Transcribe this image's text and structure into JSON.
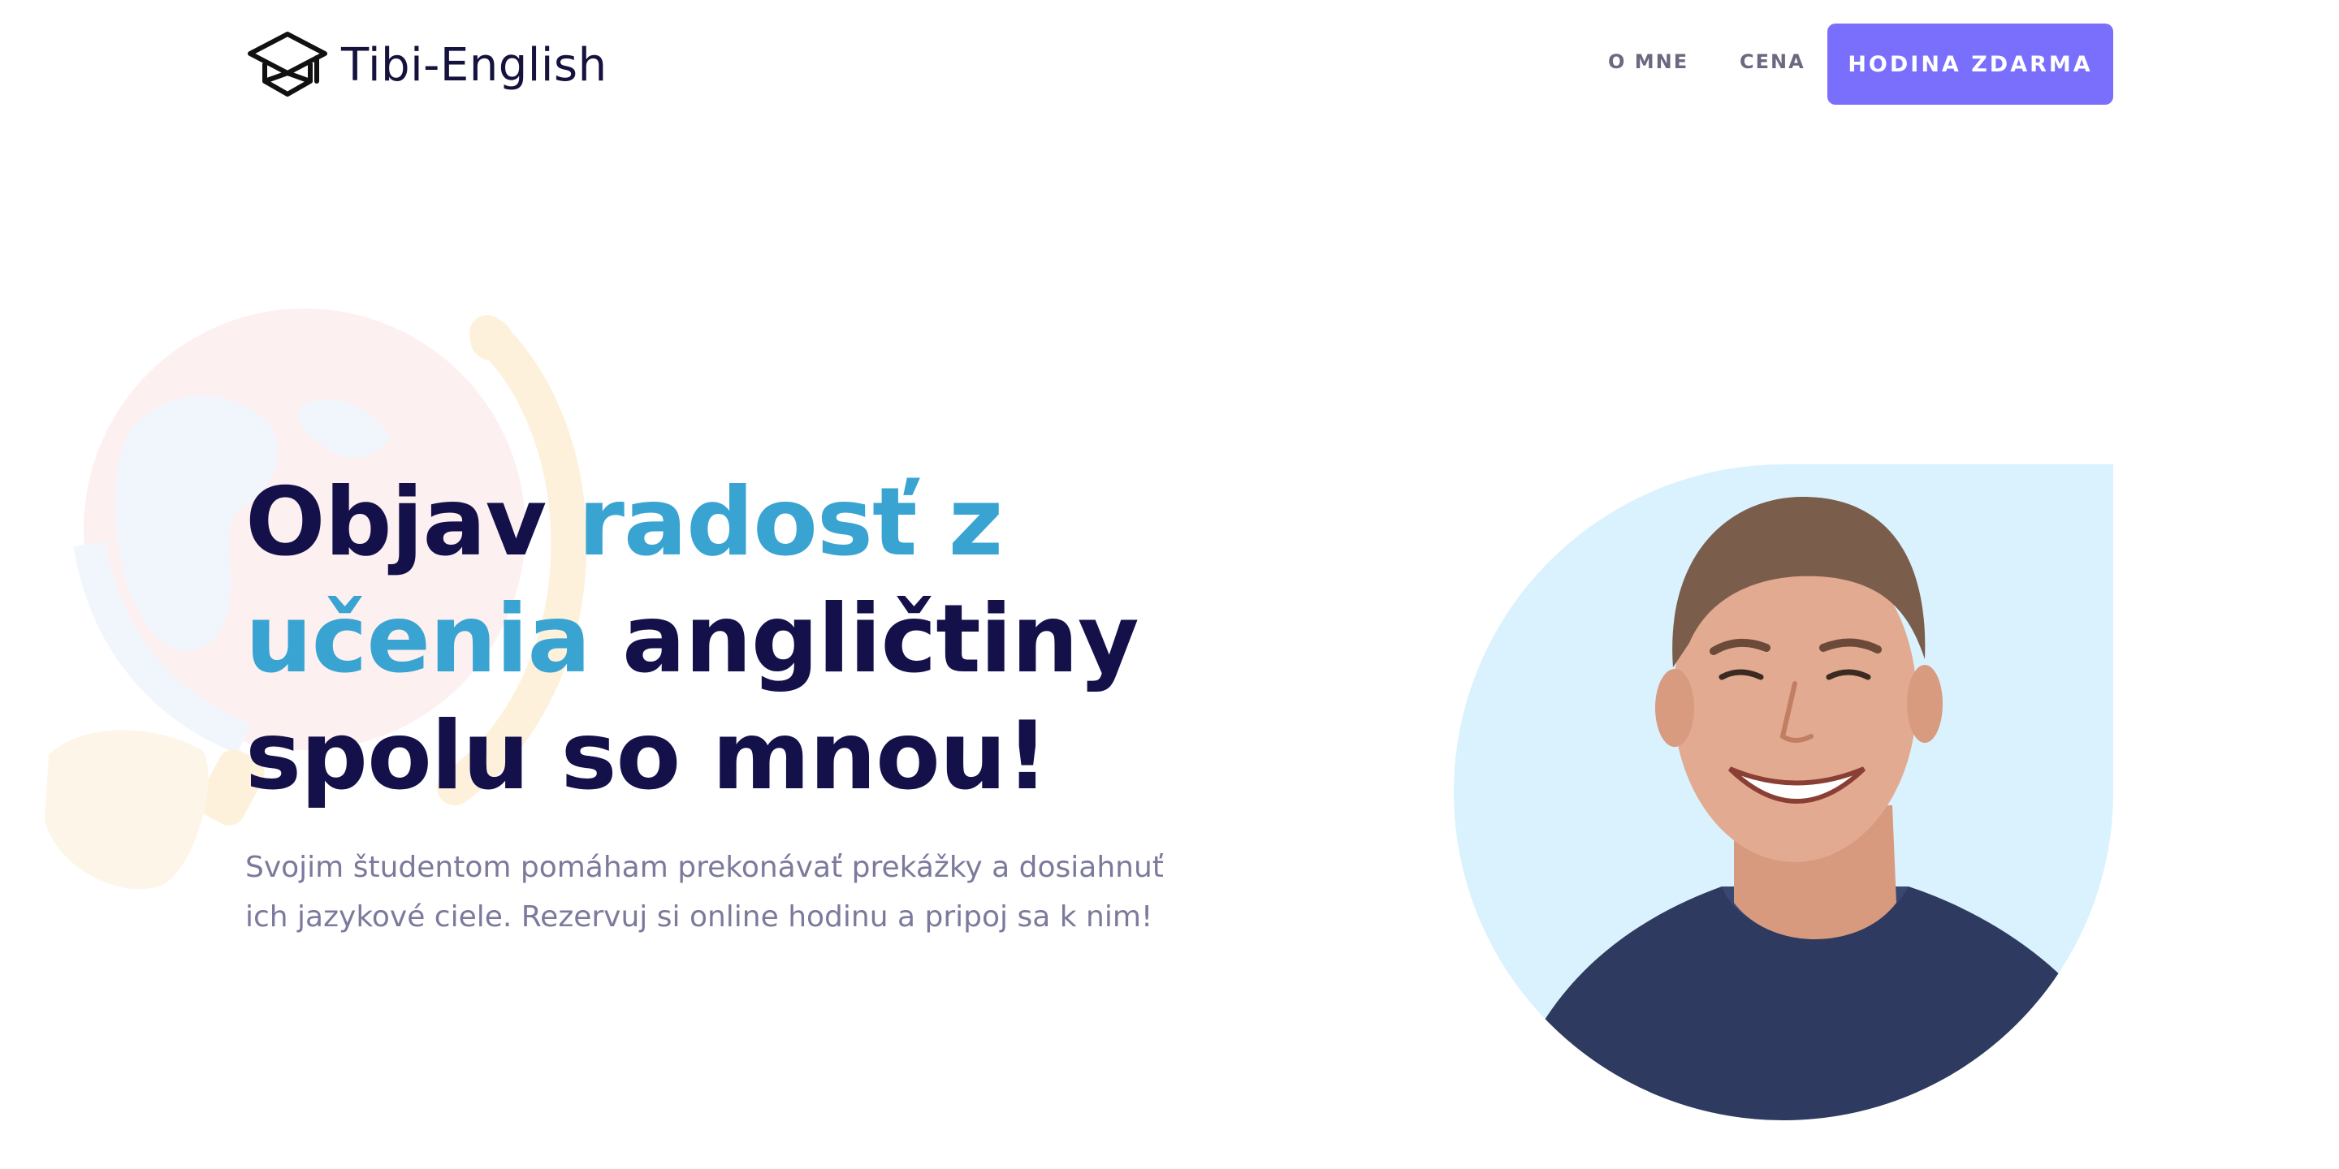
{
  "header": {
    "logo_text": "Tibi-English",
    "logo_icon": "graduation-cap-icon",
    "nav": [
      {
        "label": "O MNE"
      },
      {
        "label": "CENA"
      }
    ],
    "cta_label": "HODINA ZDARMA"
  },
  "hero": {
    "title_part1": "Objav ",
    "title_accent": "radosť z učenia",
    "title_part2": " angličtiny spolu so mnou!",
    "subtitle": "Svojim študentom pomáham prekonávať prekážky a dosiahnuť ich jazykové ciele. Rezervuj si online hodinu a pripoj sa k nim!"
  },
  "decor": {
    "background_icon": "globe-icon",
    "portrait": "tutor-photo"
  },
  "colors": {
    "accent_purple": "#7a6efc",
    "accent_blue": "#39a3d1",
    "heading_navy": "#14104a",
    "text_muted": "#7c7a9c",
    "portrait_bg": "#d9f2fd"
  }
}
